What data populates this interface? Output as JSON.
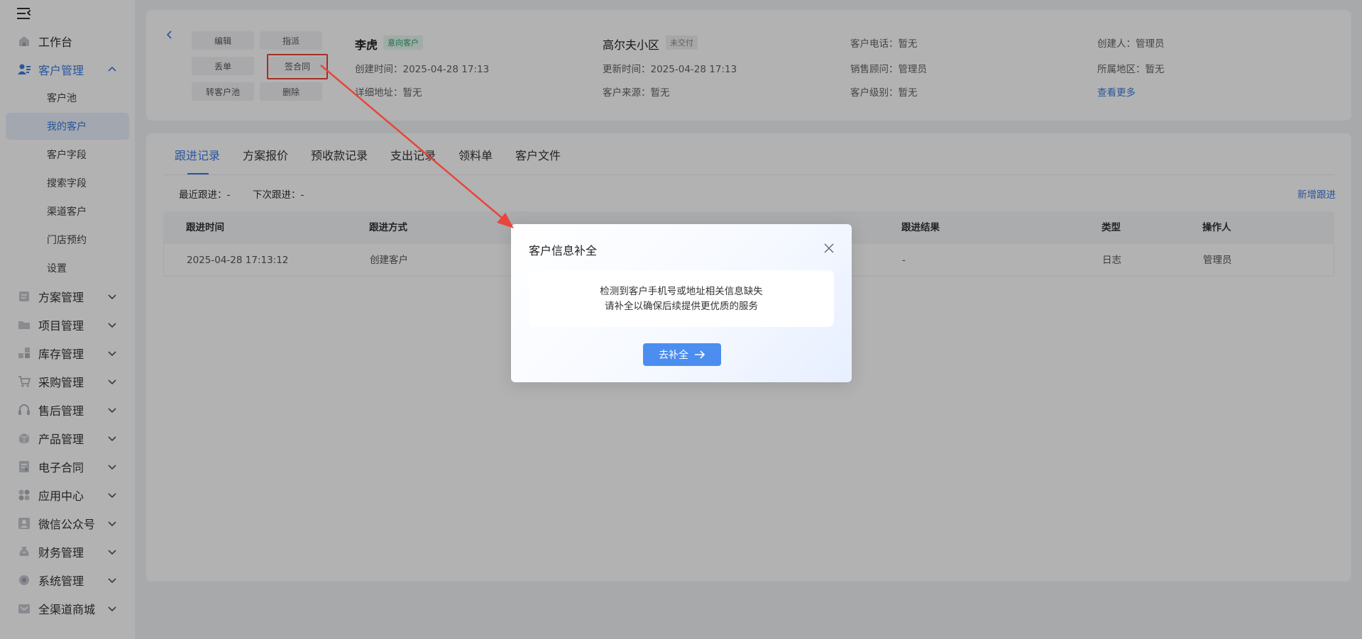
{
  "sidebar": {
    "groups": [
      {
        "label": "工作台",
        "icon": "home-icon"
      },
      {
        "label": "客户管理",
        "icon": "customer-icon"
      },
      {
        "label": "方案管理",
        "icon": "plan-icon"
      },
      {
        "label": "项目管理",
        "icon": "folder-icon"
      },
      {
        "label": "库存管理",
        "icon": "inventory-icon"
      },
      {
        "label": "采购管理",
        "icon": "cart-icon"
      },
      {
        "label": "售后管理",
        "icon": "headset-icon"
      },
      {
        "label": "产品管理",
        "icon": "box-icon"
      },
      {
        "label": "电子合同",
        "icon": "contract-icon"
      },
      {
        "label": "应用中心",
        "icon": "apps-icon"
      },
      {
        "label": "微信公众号",
        "icon": "wechat-icon"
      },
      {
        "label": "财务管理",
        "icon": "finance-icon"
      },
      {
        "label": "系统管理",
        "icon": "settings-icon"
      },
      {
        "label": "全渠道商城",
        "icon": "mall-icon"
      }
    ],
    "sub_items": [
      {
        "label": "客户池"
      },
      {
        "label": "我的客户"
      },
      {
        "label": "客户字段"
      },
      {
        "label": "搜索字段"
      },
      {
        "label": "渠道客户"
      },
      {
        "label": "门店预约"
      },
      {
        "label": "设置"
      }
    ]
  },
  "customer": {
    "actions": {
      "edit": "编辑",
      "assign": "指派",
      "drop": "丢单",
      "sign": "签合同",
      "to_pool": "转客户池",
      "delete": "删除"
    },
    "name": "李虎",
    "name_tag": "意向客户",
    "community": "高尔夫小区",
    "community_tag": "未交付",
    "created_label": "创建时间：",
    "created_value": "2025-04-28 17:13",
    "updated_label": "更新时间：",
    "updated_value": "2025-04-28 17:13",
    "address_label": "详细地址：",
    "address_value": "暂无",
    "source_label": "客户来源：",
    "source_value": "暂无",
    "phone_label": "客户电话：",
    "phone_value": "暂无",
    "sales_label": "销售顾问：",
    "sales_value": "管理员",
    "level_label": "客户级别：",
    "level_value": "暂无",
    "creator_label": "创建人：",
    "creator_value": "管理员",
    "region_label": "所属地区：",
    "region_value": "暂无",
    "more_link": "查看更多"
  },
  "tabs": [
    {
      "label": "跟进记录"
    },
    {
      "label": "方案报价"
    },
    {
      "label": "预收款记录"
    },
    {
      "label": "支出记录"
    },
    {
      "label": "领料单"
    },
    {
      "label": "客户文件"
    }
  ],
  "followup": {
    "recent_label": "最近跟进：",
    "recent_value": "-",
    "next_label": "下次跟进：",
    "next_value": "-",
    "add_link": "新增跟进",
    "columns": [
      "跟进时间",
      "跟进方式",
      "跟进结果",
      "类型",
      "操作人"
    ],
    "rows": [
      [
        "2025-04-28 17:13:12",
        "创建客户",
        "-",
        "日志",
        "管理员"
      ]
    ]
  },
  "modal": {
    "title": "客户信息补全",
    "message_line1": "检测到客户手机号或地址相关信息缺失",
    "message_line2": "请补全以确保后续提供更优质的服务",
    "button": "去补全"
  },
  "colors": {
    "accent": "#3b7be0",
    "highlight": "#e8453c",
    "modal_button": "#4b8ef0"
  }
}
